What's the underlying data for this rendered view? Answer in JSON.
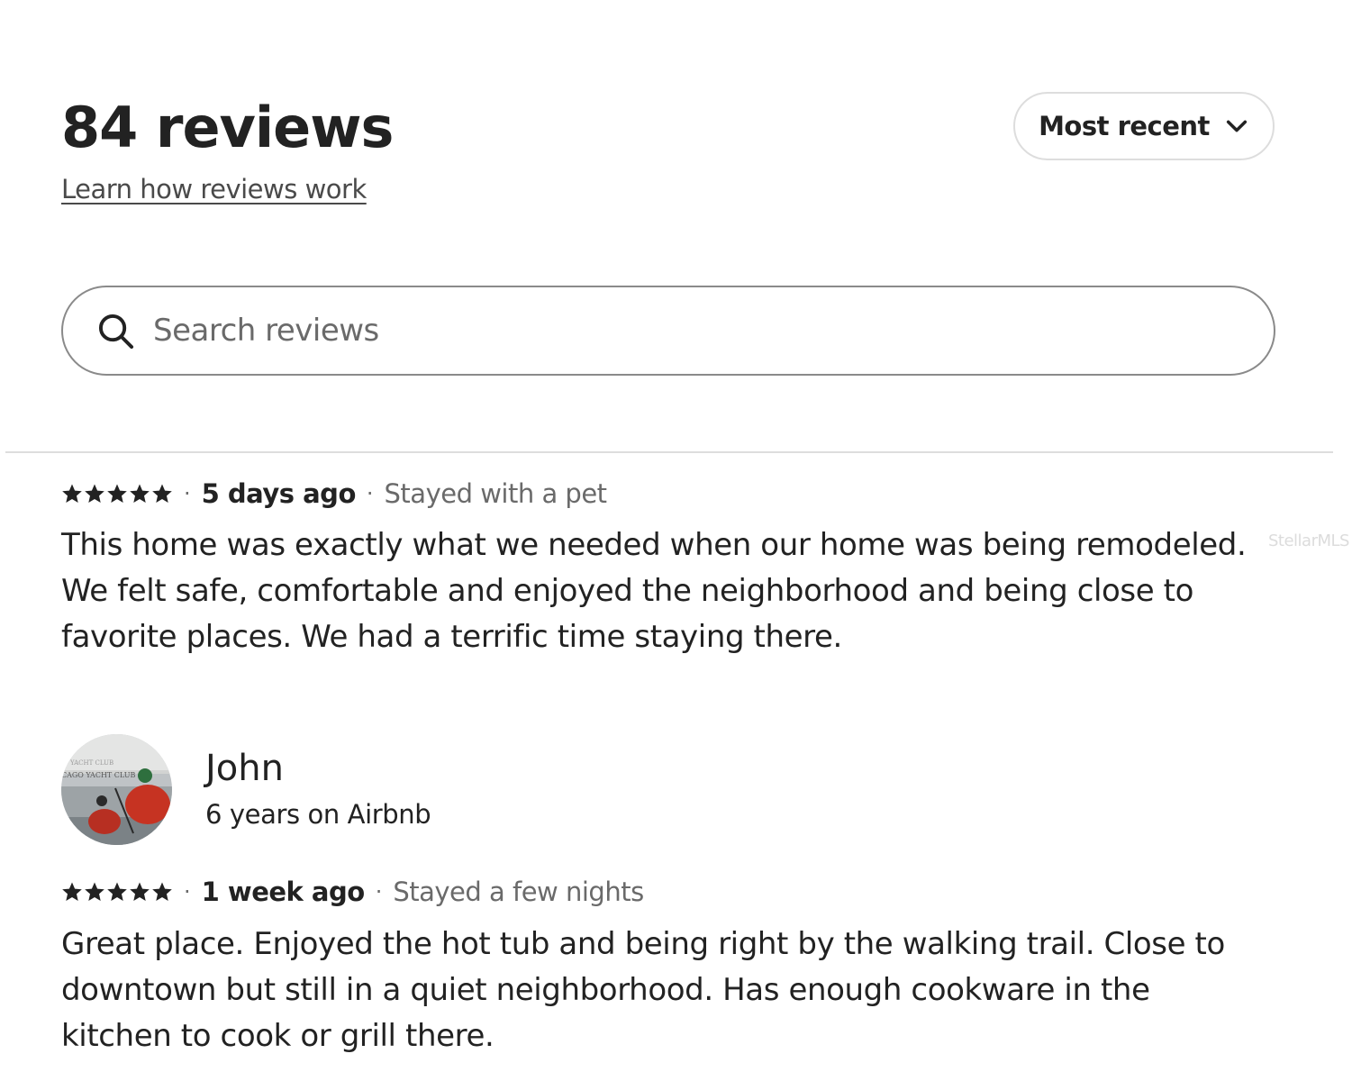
{
  "header": {
    "title": "84 reviews",
    "learn_link": "Learn how reviews work"
  },
  "sort": {
    "label": "Most recent",
    "icon": "chevron-down-icon"
  },
  "search": {
    "placeholder": "Search reviews",
    "icon": "search-icon"
  },
  "reviews": [
    {
      "rating": 5,
      "rating_max": 5,
      "when": "5 days ago",
      "stay": "Stayed with a pet",
      "text": "This home was exactly what we needed when our home was being remodeled. We felt safe, comfortable and enjoyed the neighborhood and being close to favorite places. We had a terrific time staying there."
    },
    {
      "reviewer": {
        "name": "John",
        "tenure": "6 years on Airbnb"
      },
      "rating": 5,
      "rating_max": 5,
      "when": "1 week ago",
      "stay": "Stayed a few nights",
      "text": "Great place. Enjoyed the hot tub and being right by the walking trail. Close to downtown but still in a quiet neighborhood. Has enough cookware in the kitchen to cook or grill there."
    }
  ],
  "watermark": "StellarMLS",
  "colors": {
    "text": "#222222",
    "secondary_text": "#6a6a6a",
    "divider": "#dddddd",
    "search_border": "#8a8a8a"
  }
}
